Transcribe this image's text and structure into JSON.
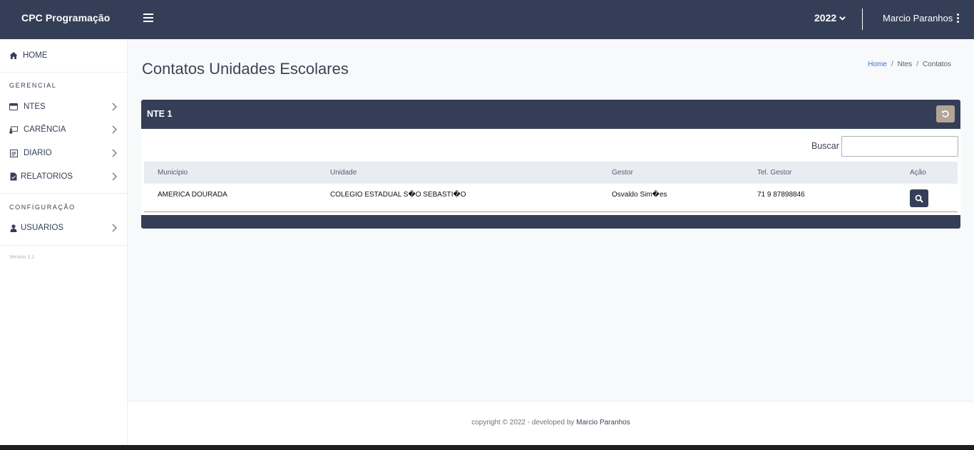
{
  "topbar": {
    "brand": "CPC Programação",
    "menu_icon": "hamburger-icon",
    "year": "2022",
    "user_name": "Marcio Paranhos"
  },
  "sidebar": {
    "home": {
      "label": "HOME",
      "icon": "home-icon"
    },
    "section_gerencial": "GERENCIAL",
    "items": [
      {
        "label": "NTES",
        "icon": "card-icon"
      },
      {
        "label": "CARÊNCIA",
        "icon": "chalkboard-icon"
      },
      {
        "label": "DIARIO",
        "icon": "calendar-icon"
      },
      {
        "label": "RELATORIOS",
        "icon": "file-icon"
      }
    ],
    "section_config": "CONFIGURAÇÃO",
    "usuarios": {
      "label": "USUARIOS",
      "icon": "user-icon"
    },
    "version": "Version 1.1"
  },
  "page": {
    "title": "Contatos Unidades Escolares",
    "breadcrumb": [
      "Home",
      "Ntes",
      "Contatos"
    ]
  },
  "card": {
    "title": "NTE 1",
    "search_label": "Buscar",
    "search_value": "",
    "columns": [
      "Municipio",
      "Unidade",
      "Gestor",
      "Tel. Gestor",
      "Ação"
    ],
    "rows": [
      {
        "municipio": "AMERICA DOURADA",
        "unidade": "COLEGIO ESTADUAL S�O SEBASTI�O",
        "gestor": "Osvaldo Sim�es",
        "tel": "71 9 87898846"
      }
    ]
  },
  "footer": {
    "prefix": "copyright © 2022 - developed by ",
    "author": "Marcio Paranhos"
  },
  "colors": {
    "topbar": "#343f57",
    "refresh_button": "#b3a595",
    "breadcrumb_link": "#3e6fd8"
  }
}
